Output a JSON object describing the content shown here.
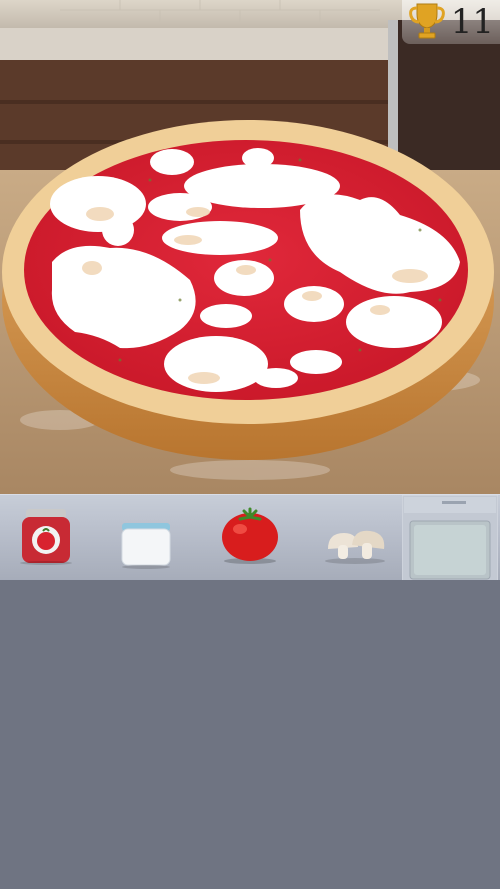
{
  "hud": {
    "score": "11",
    "trophy_icon": "trophy-icon"
  },
  "pizza": {
    "toppings": [
      "tomato-sauce",
      "mozzarella",
      "mushroom"
    ]
  },
  "tray": {
    "items": [
      {
        "name": "tomato-sauce-jar",
        "icon": "sauce-jar-icon"
      },
      {
        "name": "cheese-jar",
        "icon": "cheese-jar-icon"
      },
      {
        "name": "tomato",
        "icon": "tomato-icon"
      },
      {
        "name": "mushrooms",
        "icon": "mushroom-icon"
      },
      {
        "name": "oven",
        "icon": "oven-icon"
      }
    ]
  },
  "colors": {
    "sauce": "#d81f31",
    "crust": "#e2b37a",
    "panel": "#6f7482",
    "tray": "#b7bdca"
  }
}
